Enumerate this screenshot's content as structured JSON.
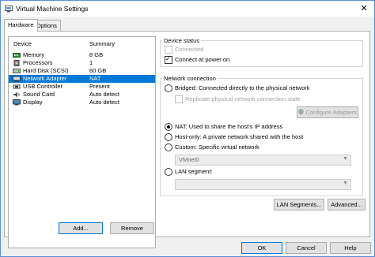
{
  "window": {
    "title": "Virtual Machine Settings",
    "close_glyph": "✕"
  },
  "tabs": [
    {
      "label": "Hardware"
    },
    {
      "label": "Options"
    }
  ],
  "device_list": {
    "header_device": "Device",
    "header_summary": "Summary",
    "rows": [
      {
        "name": "Memory",
        "summary": "8 GB",
        "icon": "memory-icon"
      },
      {
        "name": "Processors",
        "summary": "1",
        "icon": "processor-icon"
      },
      {
        "name": "Hard Disk (SCSI)",
        "summary": "60 GB",
        "icon": "hard-disk-icon"
      },
      {
        "name": "Network Adapter",
        "summary": "NAT",
        "icon": "network-adapter-icon"
      },
      {
        "name": "USB Controller",
        "summary": "Present",
        "icon": "usb-icon"
      },
      {
        "name": "Sound Card",
        "summary": "Auto detect",
        "icon": "sound-card-icon"
      },
      {
        "name": "Display",
        "summary": "Auto detect",
        "icon": "display-icon"
      }
    ]
  },
  "buttons": {
    "add": "Add...",
    "remove": "Remove",
    "lan_segments": "LAN Segments...",
    "advanced": "Advanced...",
    "configure_adapters": "Configure Adapters",
    "ok": "OK",
    "cancel": "Cancel",
    "help": "Help"
  },
  "device_status": {
    "legend": "Device status",
    "connected": "Connected",
    "connect_at_power_on": "Connect at power on"
  },
  "network_connection": {
    "legend": "Network connection",
    "bridged": "Bridged: Connected directly to the physical network",
    "replicate": "Replicate physical network connection state",
    "nat": "NAT: Used to share the host's IP address",
    "host_only": "Host-only: A private network shared with the host",
    "custom": "Custom: Specific virtual network",
    "custom_value": "VMnet0",
    "lan_segment": "LAN segment:",
    "lan_segment_value": ""
  },
  "colors": {
    "selection": "#0078d7",
    "window_border": "#5a8fd6"
  }
}
